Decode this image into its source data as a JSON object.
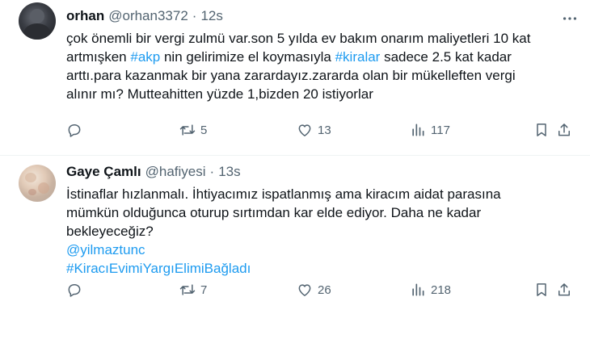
{
  "tweets": [
    {
      "name": "orhan",
      "handle": "@orhan3372",
      "dot": "·",
      "time": "12s",
      "lines": [
        "çok önemli bir vergi zulmü var.son 5 yılda ev bakım onarım maliyetleri 10 kat",
        "artmışken #akp nin gelirimize el koymasıyla #kiralar sadece 2.5 kat kadar",
        "arttı.para kazanmak bir yana zarardayız.zararda olan bir mükelleften vergi",
        "alınır mı? Mutteahitten yüzde 1,bizden 20 istiyorlar"
      ],
      "line2_parts": [
        "artmışken ",
        "#akp",
        " nin gelirimize el koymasıyla ",
        "#kiralar",
        " sadece 2.5 kat kadar"
      ],
      "retweets": "5",
      "likes": "13",
      "views": "117"
    },
    {
      "name": "Gaye Çamlı",
      "handle": "@hafiyesi",
      "dot": "·",
      "time": "13s",
      "lines": [
        "İstinaflar hızlanmalı. İhtiyacımız ispatlanmış ama kiracım aidat parasına",
        "mümkün olduğunca oturup sırtımdan kar elde ediyor. Daha ne kadar",
        "bekleyeceğiz?"
      ],
      "mention": "@yilmaztunc",
      "hashtag": "#KiracıEvimiYargıElimiBağladı",
      "retweets": "7",
      "likes": "26",
      "views": "218"
    }
  ],
  "icons": {
    "reply": "reply-icon",
    "retweet": "retweet-icon",
    "like": "heart-icon",
    "views": "views-icon",
    "bookmark": "bookmark-icon",
    "share": "share-icon",
    "more": "more-icon"
  },
  "colors": {
    "text": "#0f1419",
    "secondary": "#536471",
    "link": "#1d9bf0",
    "divider": "#eff3f4"
  }
}
